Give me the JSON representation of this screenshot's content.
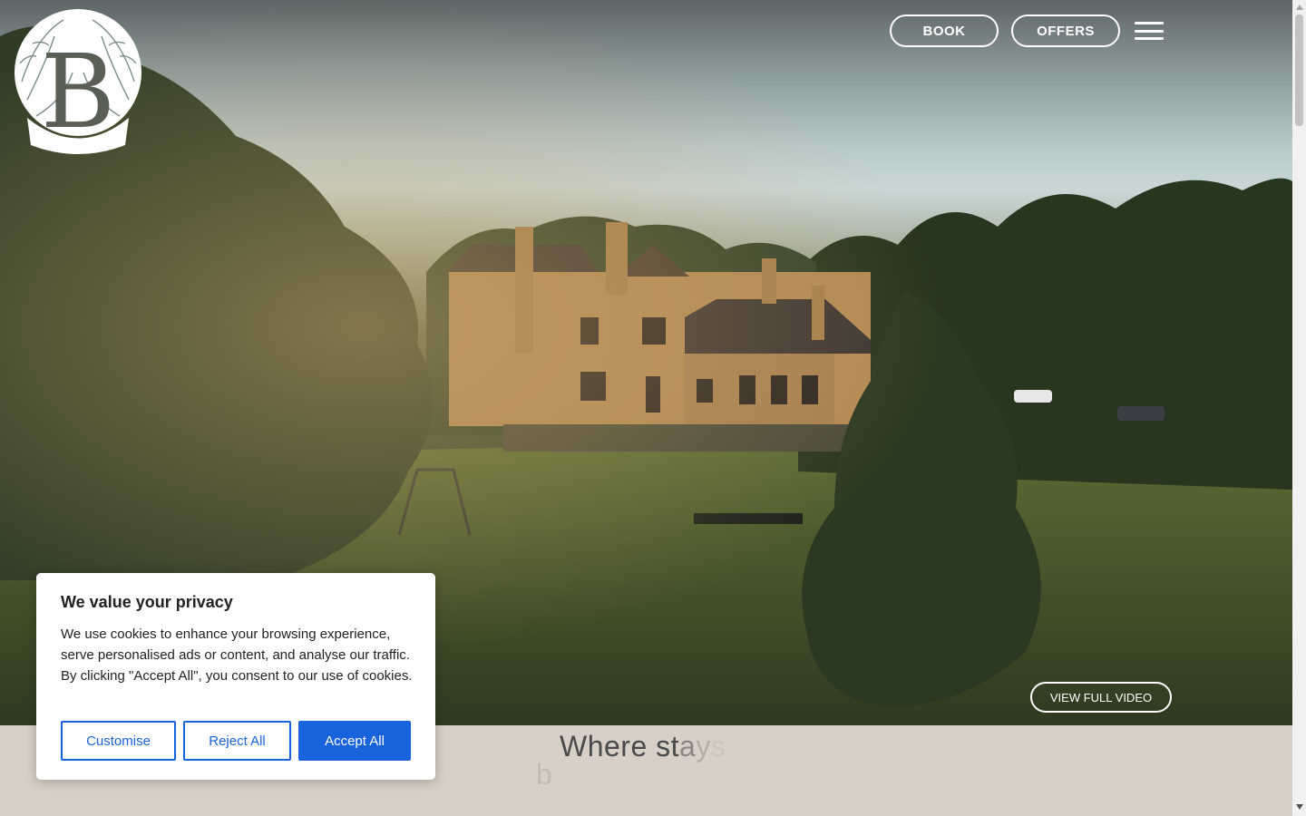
{
  "header": {
    "logo_letter": "B",
    "book_label": "BOOK",
    "offers_label": "OFFERS"
  },
  "hero": {
    "video_button_label": "VIEW FULL VIDEO"
  },
  "intro": {
    "tagline_solid": "Where st",
    "tagline_fade1": "a",
    "tagline_fade2": "y",
    "tagline_fade3": "s",
    "tagline_line2": "b"
  },
  "cookie_banner": {
    "title": "We value your privacy",
    "body": "We use cookies to enhance your browsing experience, serve personalised ads or content, and analyse our traffic. By clicking \"Accept All\", you consent to our use of cookies.",
    "customise_label": "Customise",
    "reject_label": "Reject All",
    "accept_label": "Accept All"
  },
  "colors": {
    "accent_blue": "#1863dc",
    "lower_bg": "#d8d0c6",
    "text_dark": "#212121"
  }
}
